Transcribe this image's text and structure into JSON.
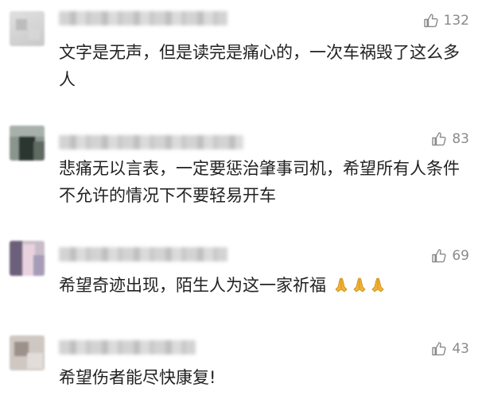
{
  "comments": [
    {
      "likes": "132",
      "text": "文字是无声，但是读完是痛心的，一次车祸毁了这么多人"
    },
    {
      "likes": "83",
      "text": "悲痛无以言表，一定要惩治肇事司机，希望所有人条件不允许的情况下不要轻易开车"
    },
    {
      "likes": "69",
      "text": "希望奇迹出现，陌生人为这一家祈福",
      "emoji": [
        "folded-hands",
        "folded-hands",
        "folded-hands"
      ]
    },
    {
      "likes": "43",
      "text": "希望伤者能尽快康复!"
    }
  ],
  "icons": {
    "like": "thumbs-up-icon"
  },
  "colors": {
    "meta_gray": "#8a8a8a",
    "text": "#222222",
    "emoji": "#f2b233"
  }
}
